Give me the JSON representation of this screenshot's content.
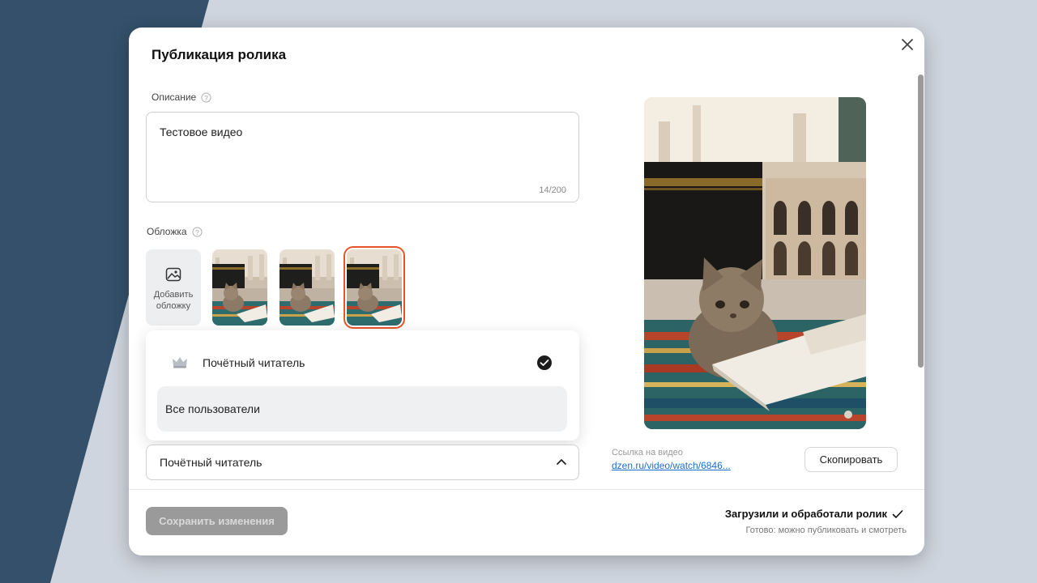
{
  "modal": {
    "title": "Публикация ролика"
  },
  "description": {
    "label": "Описание",
    "value": "Тестовое видео",
    "counter": "14/200"
  },
  "cover": {
    "label": "Обложка",
    "add_label": "Добавить обложку",
    "thumbnails": [
      "cover-option-1",
      "cover-option-2",
      "cover-option-3"
    ],
    "selected_index": 2
  },
  "access": {
    "options": [
      {
        "label": "Почётный читатель",
        "icon": "crown-icon",
        "checked": true
      },
      {
        "label": "Все пользователи",
        "checked": false
      }
    ],
    "selected_value": "Почётный читатель"
  },
  "video_link": {
    "label": "Ссылка на видео",
    "value": "dzen.ru/video/watch/6846..."
  },
  "buttons": {
    "copy": "Скопировать",
    "save": "Сохранить изменения"
  },
  "status": {
    "title": "Загрузили и обработали ролик",
    "subtitle": "Готово: можно публиковать и смотреть"
  },
  "colors": {
    "accent_selected_border": "#e8542a",
    "link": "#1a6fd1",
    "disabled_button": "#9a9a9a",
    "side_panel": "#34506a"
  }
}
